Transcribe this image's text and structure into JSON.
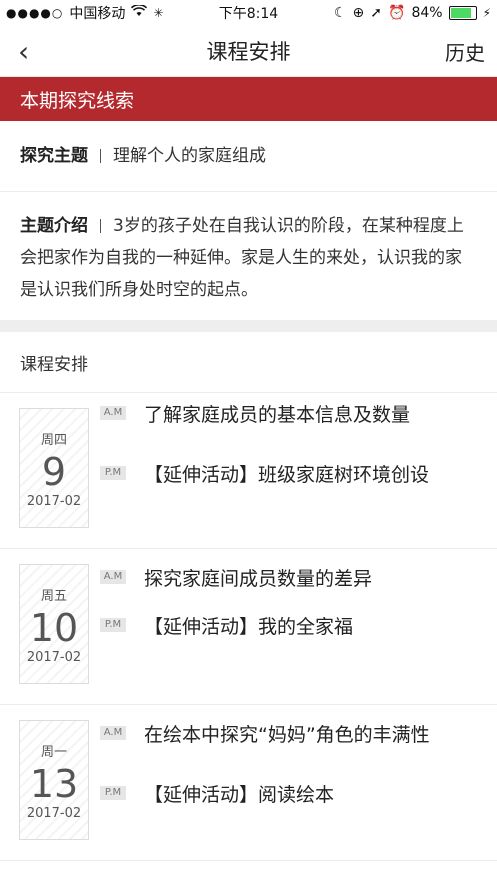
{
  "status": {
    "carrier": "中国移动",
    "time": "下午8:14",
    "battery": "84%"
  },
  "nav": {
    "back_icon": "‹",
    "title": "课程安排",
    "history": "历史"
  },
  "clue_header": "本期探究线索",
  "topic": {
    "label": "探究主题",
    "value": "理解个人的家庭组成"
  },
  "intro": {
    "label": "主题介绍",
    "value": "3岁的孩子处在自我认识的阶段，在某种程度上会把家作为自我的一种延伸。家是人生的来处，认识我的家是认识我们所身处时空的起点。"
  },
  "schedule": {
    "title": "课程安排",
    "days": [
      {
        "weekday": "周四",
        "day": "9",
        "month": "2017-02",
        "am_tag": "A.M",
        "am": "了解家庭成员的基本信息及数量",
        "pm_tag": "P.M",
        "pm": "【延伸活动】班级家庭树环境创设"
      },
      {
        "weekday": "周五",
        "day": "10",
        "month": "2017-02",
        "am_tag": "A.M",
        "am": "探究家庭间成员数量的差异",
        "pm_tag": "P.M",
        "pm": "【延伸活动】我的全家福"
      },
      {
        "weekday": "周一",
        "day": "13",
        "month": "2017-02",
        "am_tag": "A.M",
        "am": "在绘本中探究“妈妈”角色的丰满性",
        "pm_tag": "P.M",
        "pm": "【延伸活动】阅读绘本"
      }
    ]
  }
}
